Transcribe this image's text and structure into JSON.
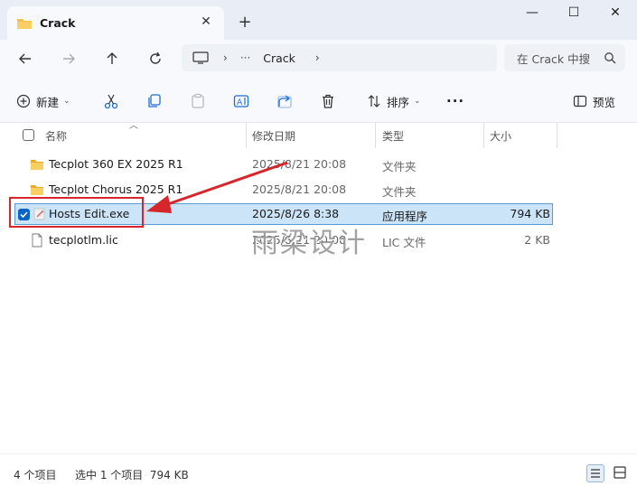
{
  "window": {
    "tab_title": "Crack",
    "new_tab_label": "+",
    "minimize_label": "—",
    "maximize_label": "☐",
    "close_label": "✕",
    "tab_close_label": "✕"
  },
  "nav": {
    "ellipsis": "···",
    "breadcrumb": "Crack",
    "search_placeholder": "在 Crack 中搜"
  },
  "toolbar": {
    "new_label": "新建",
    "sort_label": "排序",
    "more_label": "···",
    "preview_label": "预览"
  },
  "columns": {
    "name": "名称",
    "modified": "修改日期",
    "type": "类型",
    "size": "大小"
  },
  "files": [
    {
      "name": "Tecplot 360 EX 2025 R1",
      "modified": "2025/8/21 20:08",
      "type": "文件夹",
      "size": "",
      "icon": "folder-icon"
    },
    {
      "name": "Tecplot Chorus 2025 R1",
      "modified": "2025/8/21 20:08",
      "type": "文件夹",
      "size": "",
      "icon": "folder-icon"
    },
    {
      "name": "Hosts Edit.exe",
      "modified": "2025/8/26 8:38",
      "type": "应用程序",
      "size": "794 KB",
      "icon": "exe-icon"
    },
    {
      "name": "tecplotlm.lic",
      "modified": "2025/8/21 20:08",
      "type": "LIC 文件",
      "size": "2 KB",
      "icon": "file-icon"
    }
  ],
  "watermark": "雨梁设计",
  "status": {
    "count": "4 个项目",
    "selection": "选中 1 个项目  794 KB"
  },
  "colors": {
    "accent": "#0b63c4",
    "selection": "#cce4f7",
    "annotation": "#d7262b",
    "folder": "#f4c04b"
  }
}
